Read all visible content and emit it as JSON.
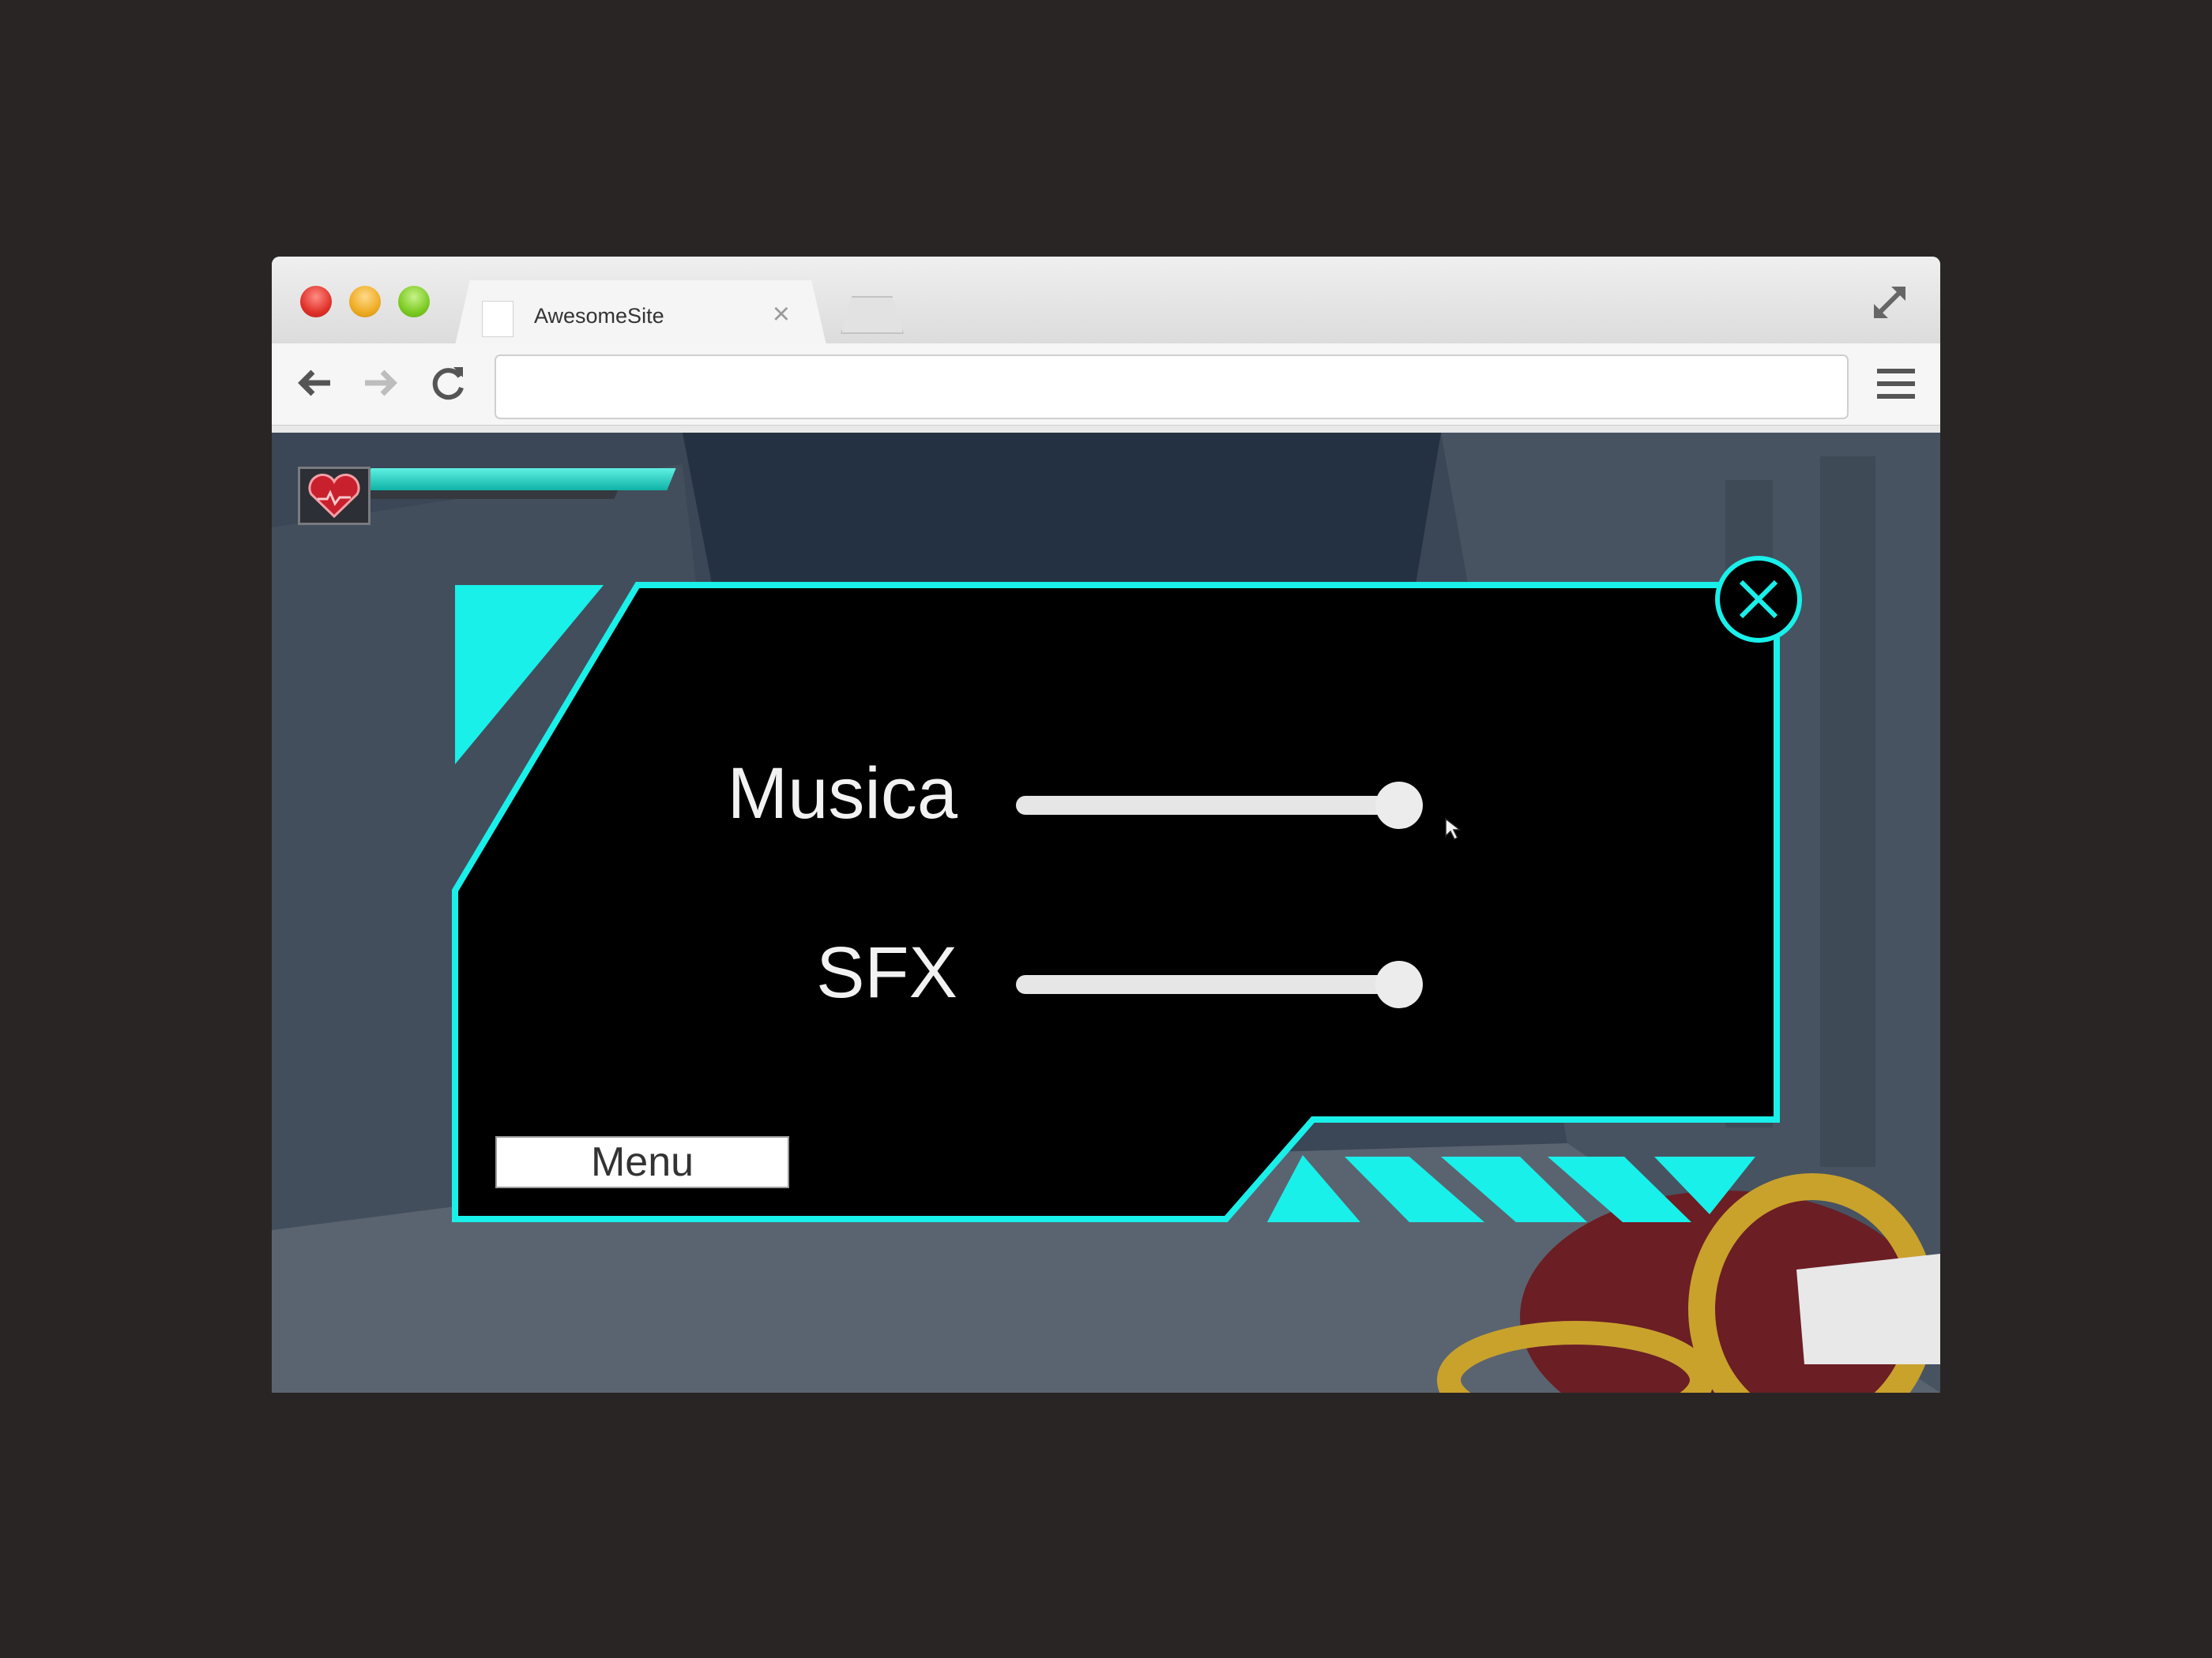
{
  "browser": {
    "tab_title": "AwesomeSite",
    "tab_close": "×",
    "url": ""
  },
  "game": {
    "health_level": 1.0,
    "settings": {
      "music_label": "Musica",
      "music_level": 0.95,
      "sfx_label": "SFX",
      "sfx_level": 0.95,
      "menu_label": "Menu"
    },
    "accent_color": "#19f0ea"
  }
}
